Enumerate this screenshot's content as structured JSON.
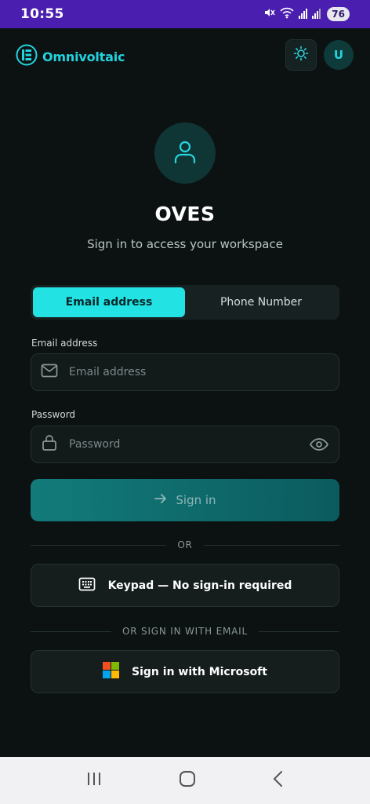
{
  "status": {
    "time": "10:55",
    "battery": "76"
  },
  "header": {
    "brand": "Omnivoltaic",
    "avatar_initial": "U"
  },
  "login": {
    "title": "OVES",
    "subtitle": "Sign in to access your workspace",
    "tabs": [
      {
        "label": "Email address",
        "active": true
      },
      {
        "label": "Phone Number",
        "active": false
      }
    ],
    "email": {
      "label": "Email address",
      "placeholder": "Email address"
    },
    "password": {
      "label": "Password",
      "placeholder": "Password"
    },
    "signin_label": "Sign in",
    "or_label": "OR",
    "keypad_label": "Keypad — No sign-in required",
    "or_email_label": "OR SIGN IN WITH EMAIL",
    "microsoft_label": "Sign in with Microsoft"
  },
  "colors": {
    "accent": "#22e2e4",
    "brand": "#22d3df",
    "status_bar": "#4a1fb0"
  },
  "icons": [
    "wifi-icon",
    "mute-icon",
    "signal-icon",
    "logo-icon",
    "sun-icon",
    "user-icon",
    "mail-icon",
    "lock-icon",
    "eye-icon",
    "arrow-right-icon",
    "keypad-icon",
    "microsoft-logo-icon",
    "recent-apps-icon",
    "home-icon",
    "back-icon"
  ]
}
